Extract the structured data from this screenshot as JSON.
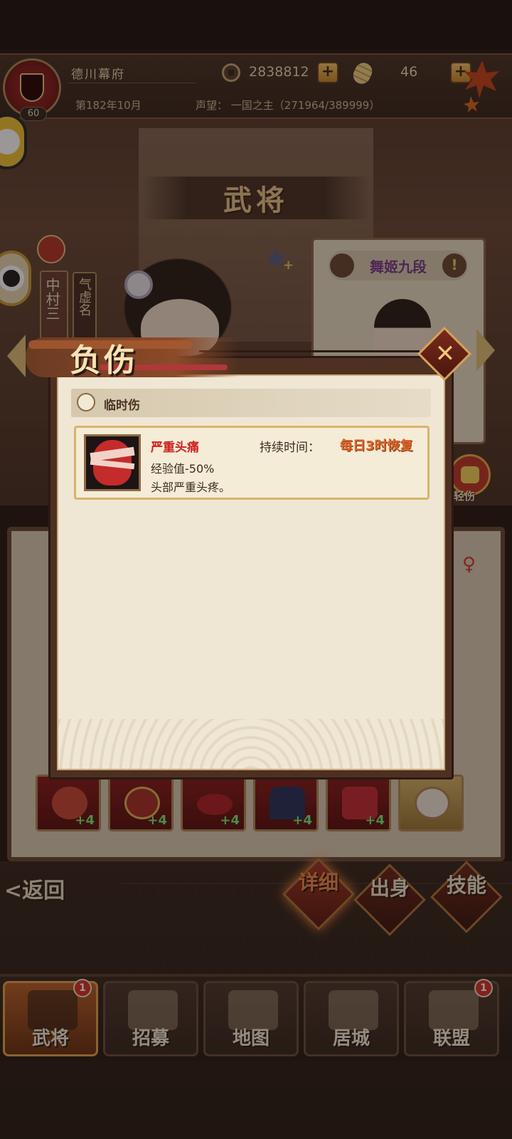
{
  "top_bar": {
    "clan_name": "德川幕府",
    "level": "60",
    "gold": "2838812",
    "rice": "46",
    "date": "第182年10月",
    "prestige": "声望：  一国之主（271964/389999）",
    "plus_symbol": "+"
  },
  "screen": {
    "title": "武将"
  },
  "character": {
    "name": "中村三",
    "trait_tag": "气虚名",
    "rank_card_title": "舞姬九段",
    "light_injury_label": "轻伤",
    "gender_symbol": "♀"
  },
  "equipment": [
    {
      "plus": "+4"
    },
    {
      "plus": "+4"
    },
    {
      "plus": "+4"
    },
    {
      "plus": "+4"
    },
    {
      "plus": "+4"
    },
    {
      "plus": ""
    }
  ],
  "actions": {
    "back_label": "<返回",
    "detail_label": "详细",
    "origin_label": "出身",
    "skill_label": "技能"
  },
  "nav": {
    "tabs": [
      {
        "label": "武将",
        "badge": "1"
      },
      {
        "label": "招募",
        "badge": ""
      },
      {
        "label": "地图",
        "badge": ""
      },
      {
        "label": "居城",
        "badge": ""
      },
      {
        "label": "联盟",
        "badge": "1"
      }
    ]
  },
  "injury_modal": {
    "title": "负伤",
    "section_title": "临时伤",
    "injury": {
      "name": "严重头痛",
      "duration_label": "持续时间：",
      "duration_value": "每日3时恢复",
      "effect": "经验值-50%",
      "description": "头部严重头疼。"
    }
  },
  "colors": {
    "accent_gold": "#e8c58a",
    "injury_red": "#d02020",
    "duration_orange": "#e2662a",
    "active_nav": "#b8632c"
  }
}
